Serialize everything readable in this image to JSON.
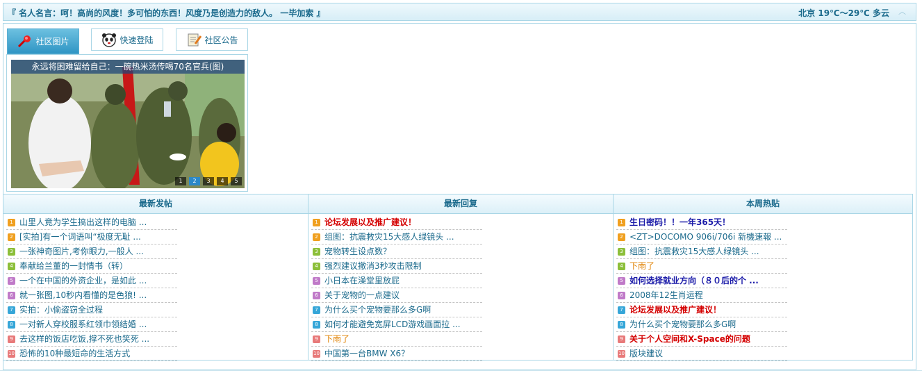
{
  "topbar": {
    "quote": "『 名人名言：呵！高尚的风度！多可怕的东西！风度乃是创造力的敌人。 一毕加索 』",
    "weather": "北京 19℃～29℃ 多云",
    "collapse_icon": "collapse-up-icon"
  },
  "tabs": [
    {
      "label": "社区图片",
      "icon": "pin-icon"
    },
    {
      "label": "快速登陆",
      "icon": "panda-icon"
    },
    {
      "label": "社区公告",
      "icon": "notepad-icon"
    }
  ],
  "slideshow": {
    "caption": "永远将困难留给自己：一碗热米汤传喝70名官兵(图)",
    "pages": [
      "1",
      "2",
      "3",
      "4",
      "5"
    ],
    "active_page": "2"
  },
  "num_colors": [
    "#f0a020",
    "#f0a020",
    "#8cbf3a",
    "#8cbf3a",
    "#c07ac8",
    "#c07ac8",
    "#36a6d8",
    "#36a6d8",
    "#e87a7a",
    "#e87a7a"
  ],
  "columns": [
    {
      "title": "最新发帖",
      "items": [
        {
          "n": "1",
          "text": "山里人竟为学生搞出这样的电脑 ...",
          "style": ""
        },
        {
          "n": "2",
          "text": "[实拍]有一个词语叫“极度无耻 ...",
          "style": ""
        },
        {
          "n": "3",
          "text": "一张神奇图片,考你眼力,一般人 ...",
          "style": ""
        },
        {
          "n": "4",
          "text": "奉献给兰董的一封情书（转）",
          "style": ""
        },
        {
          "n": "5",
          "text": "一个在中国的外资企业，是如此 ...",
          "style": ""
        },
        {
          "n": "6",
          "text": "就一张图,10秒内看懂的是色狼! ...",
          "style": ""
        },
        {
          "n": "7",
          "text": "实拍：小偷盗窃全过程",
          "style": ""
        },
        {
          "n": "8",
          "text": "一对新人穿校服系红领巾领结婚 ...",
          "style": ""
        },
        {
          "n": "9",
          "text": "去这样的饭店吃饭,撑不死也笑死 ...",
          "style": ""
        },
        {
          "n": "10",
          "text": "恐怖的10种最短命的生活方式",
          "style": ""
        }
      ]
    },
    {
      "title": "最新回复",
      "items": [
        {
          "n": "1",
          "text": "论坛发展以及推广建议！",
          "style": "red"
        },
        {
          "n": "2",
          "text": "组图：抗震救灾15大感人绿镜头 ...",
          "style": ""
        },
        {
          "n": "3",
          "text": "宠物转生设点数？",
          "style": ""
        },
        {
          "n": "4",
          "text": "强烈建议撤消3秒攻击限制",
          "style": ""
        },
        {
          "n": "5",
          "text": "小日本在澡堂里放屁",
          "style": ""
        },
        {
          "n": "6",
          "text": "关于宠物的一点建议",
          "style": ""
        },
        {
          "n": "7",
          "text": "为什么买个宠物要那么多G啊",
          "style": ""
        },
        {
          "n": "8",
          "text": "如何才能避免宽屏LCD游戏画面拉 ...",
          "style": ""
        },
        {
          "n": "9",
          "text": "下雨了",
          "style": "orange"
        },
        {
          "n": "10",
          "text": "中国第一台BMW X6？",
          "style": ""
        }
      ]
    },
    {
      "title": "本周热贴",
      "items": [
        {
          "n": "1",
          "text": "生日密码！！一年365天！",
          "style": "blue"
        },
        {
          "n": "2",
          "text": "<ZT>DOCOMO 906i/706i 新機速報 ...",
          "style": ""
        },
        {
          "n": "3",
          "text": "组图：抗震救灾15大感人绿镜头 ...",
          "style": ""
        },
        {
          "n": "4",
          "text": "下雨了",
          "style": "orange"
        },
        {
          "n": "5",
          "text": "如何选择就业方向（８０后的个 ...",
          "style": "blue"
        },
        {
          "n": "6",
          "text": "2008年12生肖运程",
          "style": ""
        },
        {
          "n": "7",
          "text": "论坛发展以及推广建议！",
          "style": "red"
        },
        {
          "n": "8",
          "text": "为什么买个宠物要那么多G啊",
          "style": ""
        },
        {
          "n": "9",
          "text": "关于个人空间和X-Space的问题",
          "style": "red"
        },
        {
          "n": "10",
          "text": "版块建议",
          "style": ""
        }
      ]
    }
  ]
}
